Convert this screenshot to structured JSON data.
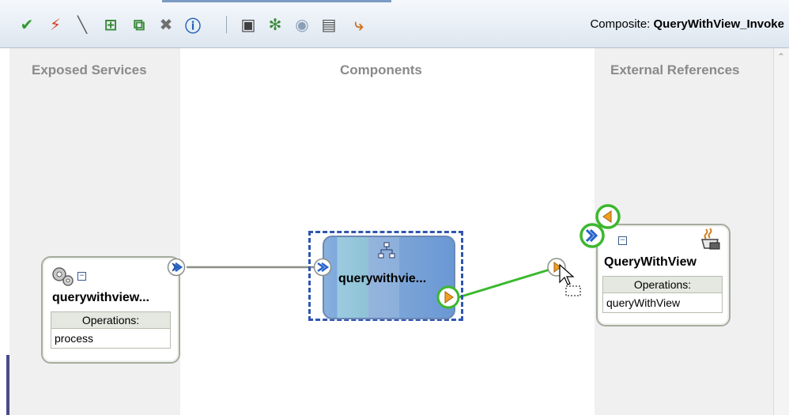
{
  "toolbar": {
    "buttons": [
      {
        "name": "validate-icon",
        "glyph": "✔",
        "color": "#2e9a2e"
      },
      {
        "name": "deploy-icon",
        "glyph": "⚡",
        "color": "#d04020"
      },
      {
        "name": "wire-icon",
        "glyph": "╲",
        "color": "#606060"
      },
      {
        "name": "add-icon",
        "glyph": "⊞",
        "color": "#3a8a3a"
      },
      {
        "name": "group-icon",
        "glyph": "⧉",
        "color": "#3a8a3a"
      },
      {
        "name": "delete-icon",
        "glyph": "✖",
        "color": "#707070"
      },
      {
        "name": "info-icon",
        "glyph": "ⓘ",
        "color": "#1f5fb8"
      },
      {
        "name": "edit-icon",
        "glyph": "▣",
        "color": "#404040"
      },
      {
        "name": "sparkle-icon",
        "glyph": "✻",
        "color": "#3a8a3a"
      },
      {
        "name": "database-icon",
        "glyph": "◉",
        "color": "#8aa0b8"
      },
      {
        "name": "document-icon",
        "glyph": "▤",
        "color": "#505050"
      },
      {
        "name": "route-icon",
        "glyph": "⤷",
        "color": "#d07020"
      }
    ],
    "composite_label": "Composite:",
    "composite_name": "QueryWithView_Invoke"
  },
  "lanes": {
    "exposed_services": "Exposed Services",
    "components": "Components",
    "external_references": "External References"
  },
  "service": {
    "title": "querywithview...",
    "operations_label": "Operations:",
    "operations": [
      "process"
    ],
    "icon": "gears-icon"
  },
  "component": {
    "title": "querywithvie...",
    "icon": "process-tree-icon"
  },
  "reference": {
    "title": "QueryWithView",
    "operations_label": "Operations:",
    "operations": [
      "queryWithView"
    ],
    "icon": "adapter-icon"
  },
  "colors": {
    "port_blue": "#2563c8",
    "port_orange": "#f0a020",
    "highlight_green": "#3cb82e",
    "wire_gray": "#8a8f86",
    "selection_dash": "#2f56b0"
  }
}
